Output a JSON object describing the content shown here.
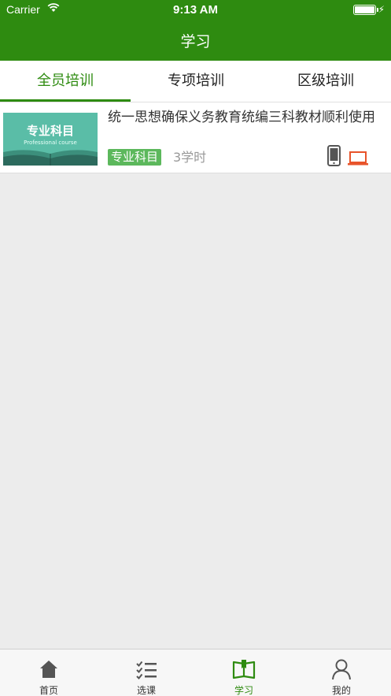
{
  "status_bar": {
    "carrier": "Carrier",
    "time": "9:13 AM"
  },
  "nav": {
    "title": "学习"
  },
  "tabs": [
    {
      "label": "全员培训",
      "active": true
    },
    {
      "label": "专项培训",
      "active": false
    },
    {
      "label": "区级培训",
      "active": false
    }
  ],
  "courses": [
    {
      "thumb_title": "专业科目",
      "thumb_subtitle": "Professional course",
      "title": "统一思想确保义务教育统编三科教材顺利使用",
      "badge": "专业科目",
      "hours": "3学时",
      "devices": [
        "phone-icon",
        "laptop-icon"
      ]
    }
  ],
  "tabbar": [
    {
      "label": "首页",
      "icon": "home-icon",
      "active": false
    },
    {
      "label": "选课",
      "icon": "checklist-icon",
      "active": false
    },
    {
      "label": "学习",
      "icon": "book-icon",
      "active": true
    },
    {
      "label": "我的",
      "icon": "user-icon",
      "active": false
    }
  ],
  "colors": {
    "brand": "#2e8b10",
    "badge": "#5cb85c",
    "laptop": "#e8542b",
    "background": "#ececec"
  }
}
